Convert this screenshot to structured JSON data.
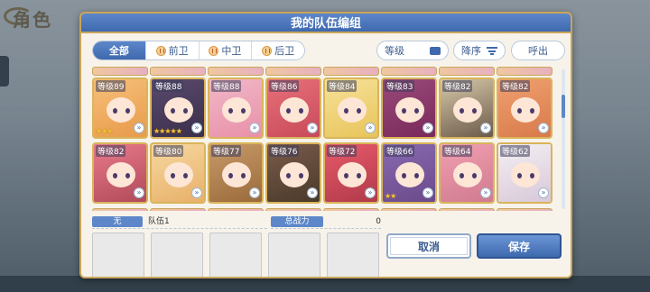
{
  "background": {
    "title": "角色"
  },
  "dialog": {
    "title": "我的队伍编组"
  },
  "tabs": [
    {
      "label": "全部",
      "active": true,
      "icon": ""
    },
    {
      "label": "前卫",
      "active": false,
      "icon": "front-position-icon"
    },
    {
      "label": "中卫",
      "active": false,
      "icon": "middle-position-icon"
    },
    {
      "label": "后卫",
      "active": false,
      "icon": "back-position-icon"
    }
  ],
  "sort": {
    "level_label": "等级",
    "order_label": "降序",
    "summon_label": "呼出"
  },
  "characters": [
    {
      "level": "等级89",
      "stars": "★★★",
      "colors": [
        "#f6c07a",
        "#e89a4a"
      ]
    },
    {
      "level": "等级88",
      "stars": "★★★★★",
      "colors": [
        "#5a4a6e",
        "#3a2f4a"
      ]
    },
    {
      "level": "等级88",
      "stars": "",
      "colors": [
        "#f2b8c8",
        "#e890a8"
      ]
    },
    {
      "level": "等级86",
      "stars": "",
      "colors": [
        "#e8707a",
        "#c84a5a"
      ]
    },
    {
      "level": "等级84",
      "stars": "",
      "colors": [
        "#f6e29a",
        "#e8c45a"
      ]
    },
    {
      "level": "等级83",
      "stars": "",
      "colors": [
        "#9a4a7a",
        "#7a2a5a"
      ]
    },
    {
      "level": "等级82",
      "stars": "",
      "colors": [
        "#d8c8a8",
        "#6a5a4a"
      ]
    },
    {
      "level": "等级82",
      "stars": "",
      "colors": [
        "#f0a070",
        "#d87a4a"
      ]
    },
    {
      "level": "等级82",
      "stars": "",
      "colors": [
        "#e87a8a",
        "#b04a5a"
      ]
    },
    {
      "level": "等级80",
      "stars": "",
      "colors": [
        "#f6d8a0",
        "#e8b06a"
      ]
    },
    {
      "level": "等级77",
      "stars": "",
      "colors": [
        "#c89a6a",
        "#9a6a3a"
      ]
    },
    {
      "level": "等级76",
      "stars": "",
      "colors": [
        "#7a5a4a",
        "#4a3a2a"
      ]
    },
    {
      "level": "等级72",
      "stars": "",
      "colors": [
        "#e85a6a",
        "#b03a4a"
      ]
    },
    {
      "level": "等级66",
      "stars": "★★",
      "colors": [
        "#8a6ab0",
        "#6a4a8a"
      ]
    },
    {
      "level": "等级64",
      "stars": "",
      "colors": [
        "#f0a0b0",
        "#d07a90"
      ]
    },
    {
      "level": "等级62",
      "stars": "",
      "colors": [
        "#f4f0f4",
        "#d8c8d8"
      ]
    }
  ],
  "team": {
    "tag": "无",
    "name": "队伍1",
    "power_label": "总战力",
    "power_value": "0"
  },
  "buttons": {
    "cancel": "取消",
    "save": "保存"
  }
}
